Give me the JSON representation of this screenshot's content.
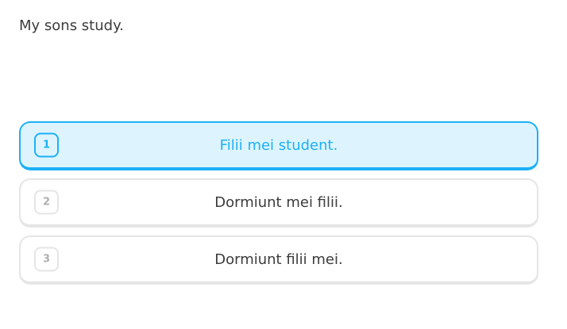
{
  "prompt": "My sons study.",
  "choices": [
    {
      "number": "1",
      "text": "Filii mei student.",
      "selected": true
    },
    {
      "number": "2",
      "text": "Dormiunt mei filii.",
      "selected": false
    },
    {
      "number": "3",
      "text": "Dormiunt filii mei.",
      "selected": false
    }
  ],
  "colors": {
    "accent": "#1cb0f6",
    "selected_bg": "#ddf4ff",
    "border": "#e5e5e5",
    "text": "#3c3c3c",
    "muted": "#afafaf"
  }
}
